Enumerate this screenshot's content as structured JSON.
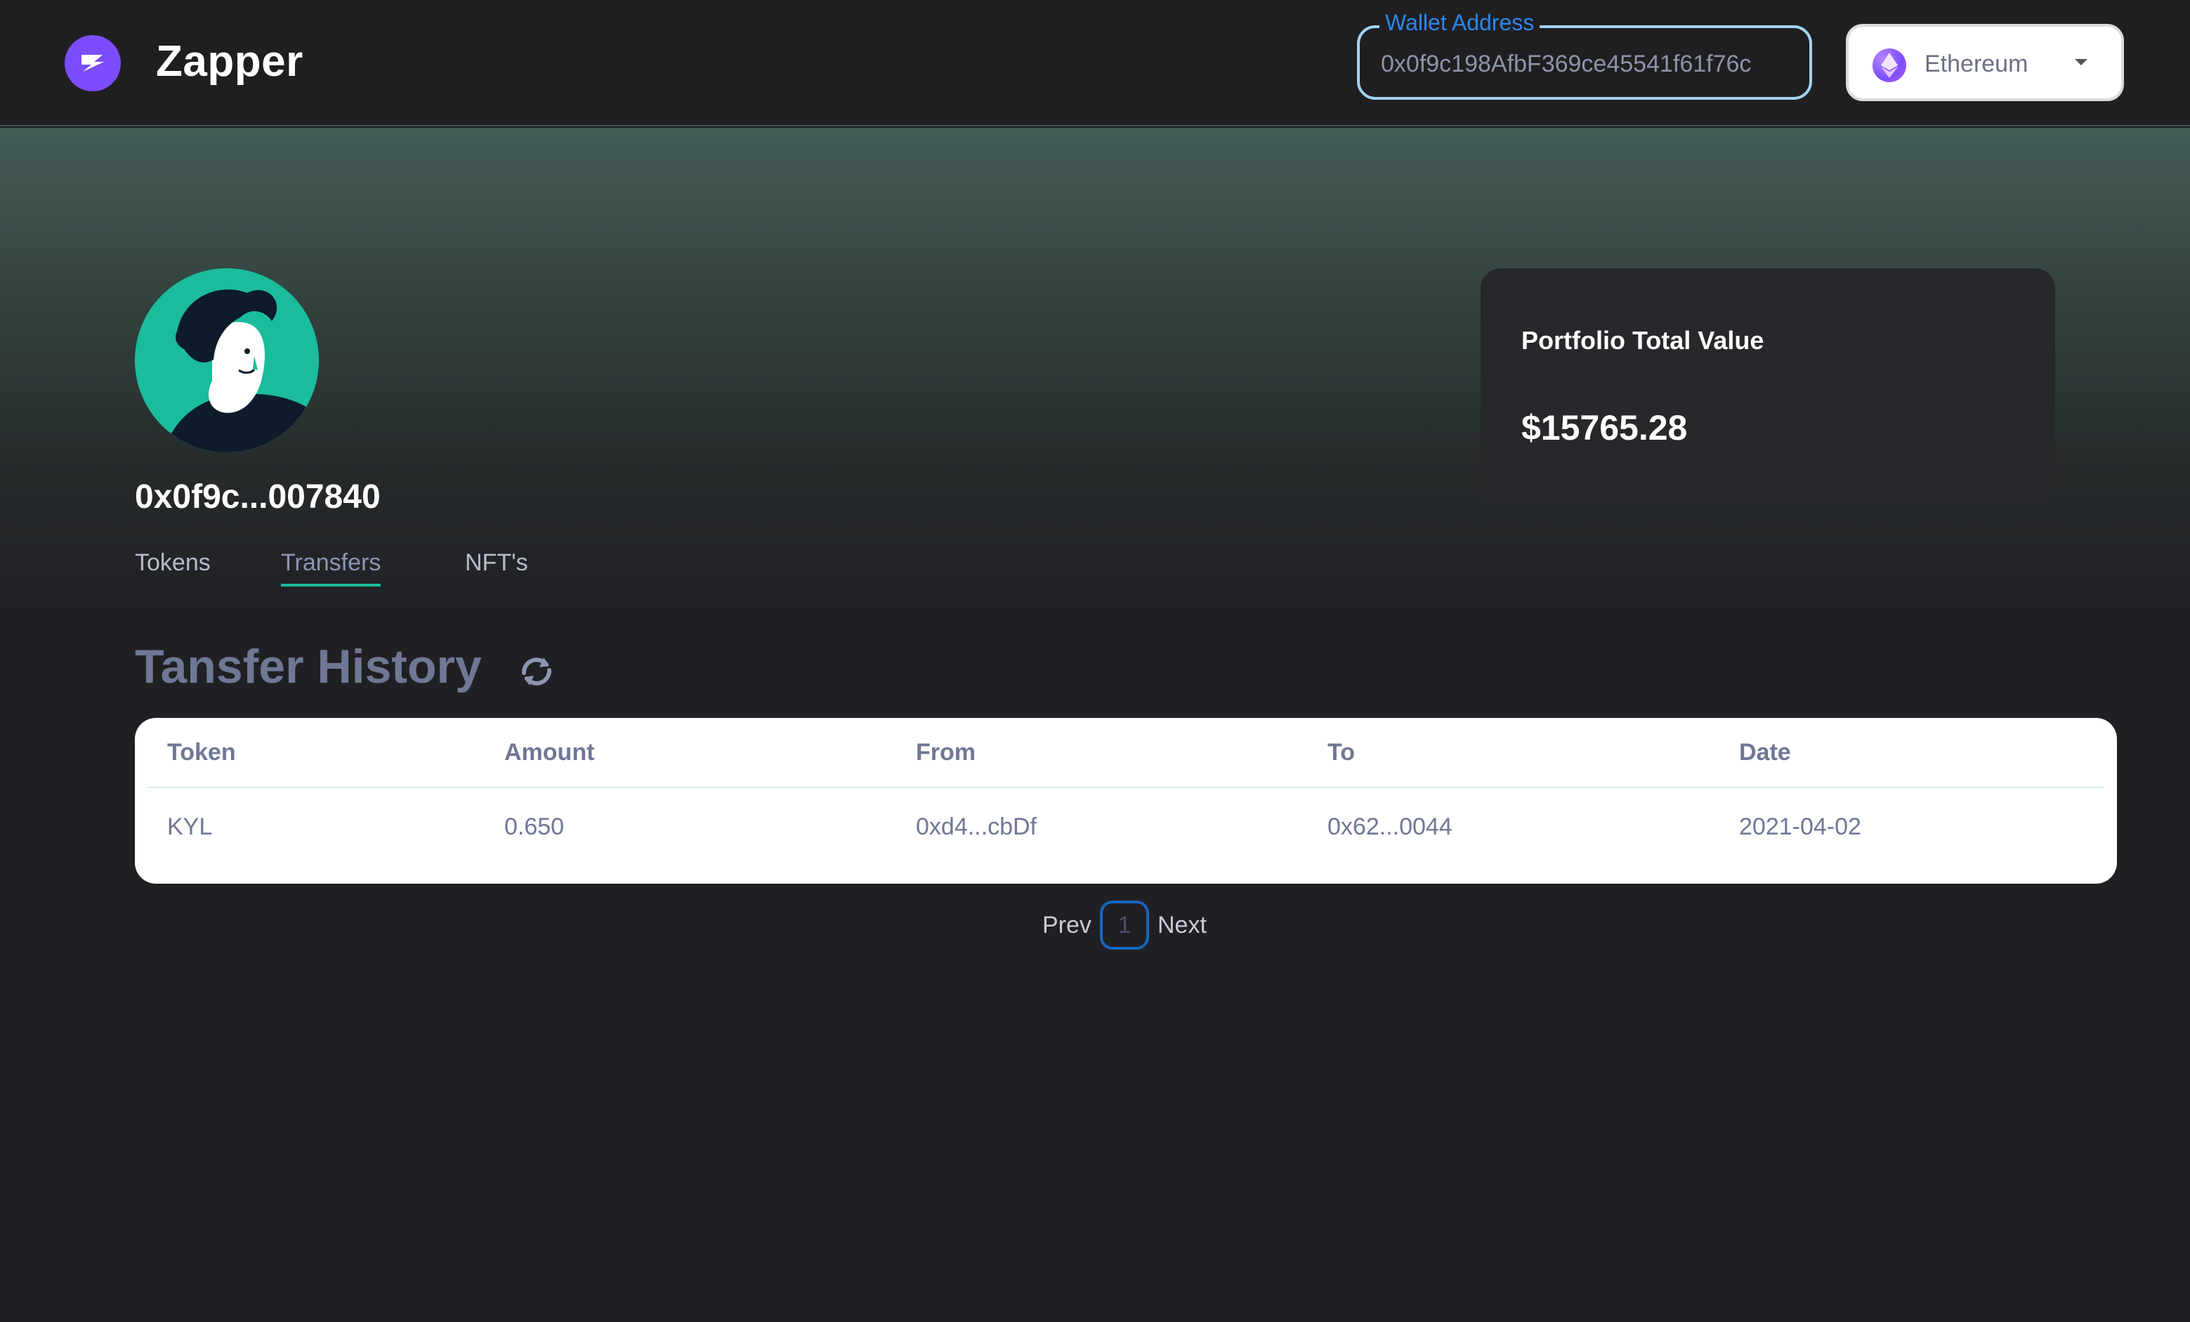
{
  "header": {
    "app_name": "Zapper",
    "wallet_label": "Wallet Address",
    "wallet_value": "0x0f9c198AfbF369ce45541f61f76c",
    "network": "Ethereum"
  },
  "profile": {
    "address_short": "0x0f9c...007840",
    "tabs": [
      "Tokens",
      "Transfers",
      "NFT's"
    ],
    "active_tab": "Transfers"
  },
  "portfolio": {
    "label": "Portfolio Total Value",
    "value": "$15765.28"
  },
  "transfers": {
    "title": "Tansfer History",
    "columns": [
      "Token",
      "Amount",
      "From",
      "To",
      "Date"
    ],
    "rows": [
      [
        "KYL",
        "0.650",
        "0xd4...cbDf",
        "0x62...0044",
        "2021-04-02"
      ]
    ]
  },
  "pagination": {
    "prev": "Prev",
    "current": "1",
    "next": "Next"
  },
  "colors": {
    "brand": "#7c4dff",
    "accent": "#1abc9c",
    "focus": "#2f86e6"
  }
}
